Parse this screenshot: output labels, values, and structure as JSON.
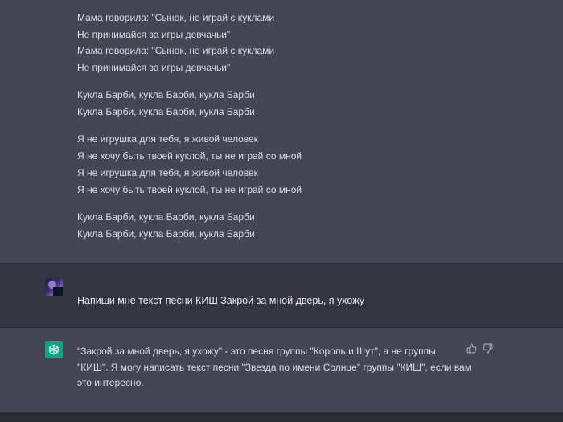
{
  "previous_response": {
    "lines": [
      "Мама говорила: \"Сынок, не играй с куклами",
      "Не принимайся за игры девчачьи\"",
      "Мама говорила: \"Сынок, не играй с куклами",
      "Не принимайся за игры девчачьи\"",
      "Кукла Барби, кукла Барби, кукла Барби",
      "Кукла Барби, кукла Барби, кукла Барби",
      "Я не игрушка для тебя, я живой человек",
      "Я не хочу быть твоей куклой, ты не играй со мной",
      "Я не игрушка для тебя, я живой человек",
      "Я не хочу быть твоей куклой, ты не играй со мной",
      "Кукла Барби, кукла Барби, кукла Барби",
      "Кукла Барби, кукла Барби, кукла Барби"
    ]
  },
  "user_message": {
    "text": "Напиши мне текст песни КИШ Закрой за мной дверь, я ухожу",
    "avatar_icon": "user-avatar"
  },
  "assistant_message": {
    "icon": "openai-logo-icon",
    "icon_bg": "#10a37f",
    "lines": [
      "\"Закрой за мной дверь, я ухожу\" - это песня группы \"Король и Шут\", а не группы",
      "\"КИШ\". Я могу написать текст песни \"Звезда по имени Солнце\" группы \"КИШ\", если вам",
      "это интересно."
    ],
    "feedback_icons": [
      "thumbs-up-icon",
      "thumbs-down-icon"
    ]
  }
}
